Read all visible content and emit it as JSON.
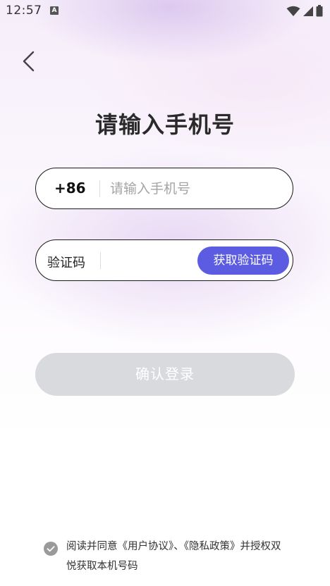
{
  "status_bar": {
    "time": "12:57",
    "notification_badge": "A"
  },
  "header": {
    "title": "请输入手机号"
  },
  "phone": {
    "country_code": "+86",
    "placeholder": "请输入手机号",
    "value": ""
  },
  "code": {
    "label": "验证码",
    "value": "",
    "get_code_label": "获取验证码"
  },
  "confirm": {
    "label": "确认登录"
  },
  "agreement": {
    "prefix": "阅读并同意",
    "user_agreement": "《用户协议》",
    "separator": "、",
    "privacy_policy": "《隐私政策》",
    "suffix": "并授权双悦获取本机号码",
    "checked": true
  },
  "colors": {
    "accent": "#5b5ce2",
    "disabled_button": "#d8dade",
    "check_gray": "#9a9a9a"
  },
  "icons": {
    "back": "chevron-left-icon",
    "wifi": "wifi-icon",
    "signal": "signal-icon",
    "battery": "battery-icon",
    "check": "check-circle-icon"
  }
}
